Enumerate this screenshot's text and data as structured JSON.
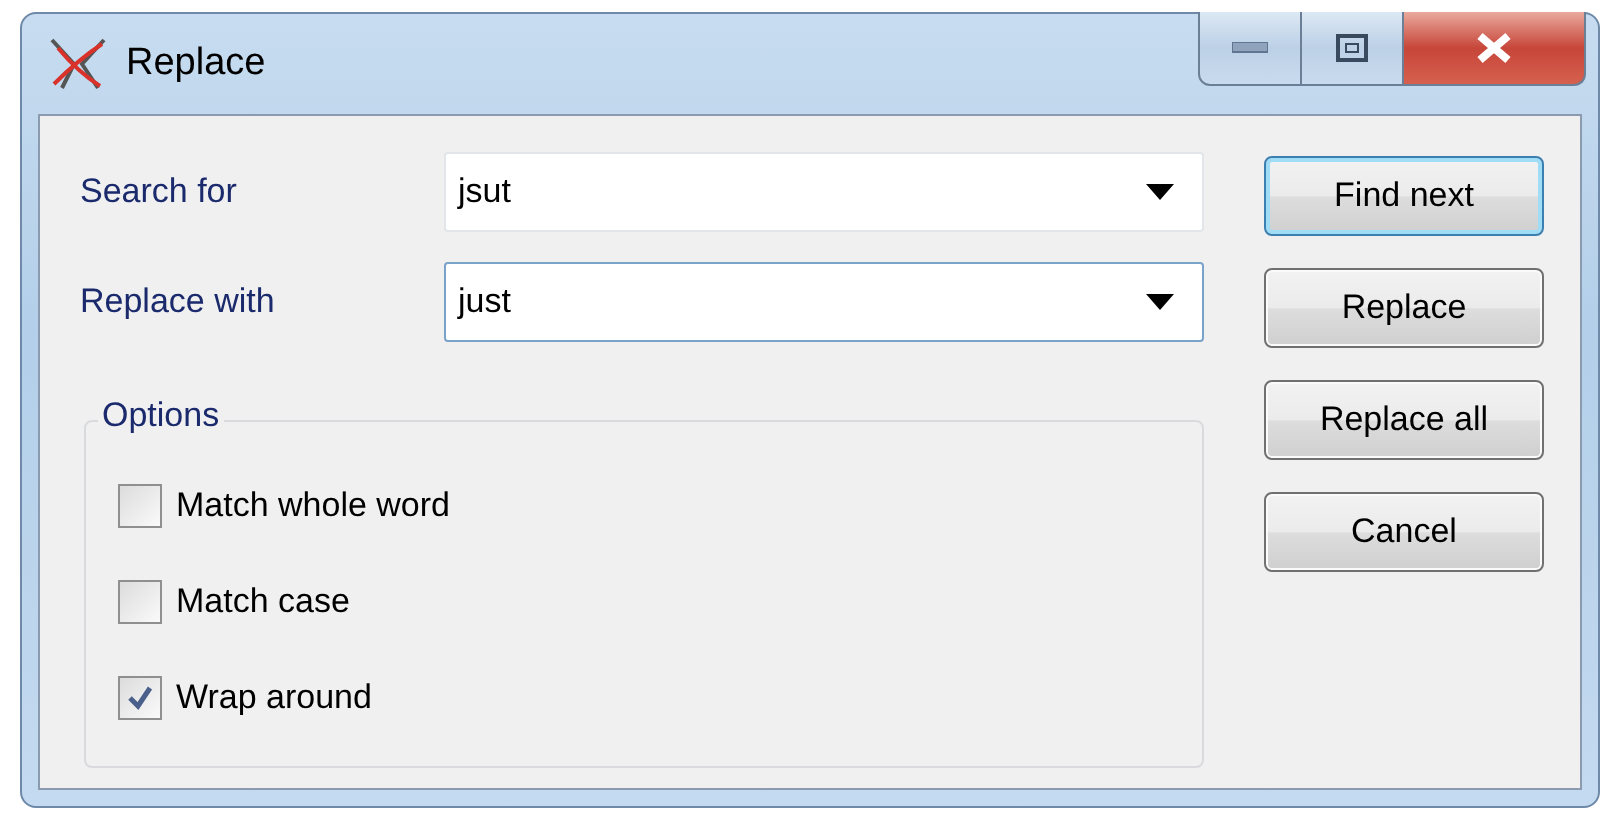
{
  "window": {
    "title": "Replace",
    "controls": [
      {
        "kind": "minimize"
      },
      {
        "kind": "maximize"
      },
      {
        "kind": "close"
      }
    ]
  },
  "fields": [
    {
      "label": "Search for",
      "value": "jsut",
      "focused": false
    },
    {
      "label": "Replace with",
      "value": "just",
      "focused": true
    }
  ],
  "options": {
    "title": "Options",
    "items": [
      {
        "label": "Match whole word",
        "checked": false
      },
      {
        "label": "Match case",
        "checked": false
      },
      {
        "label": "Wrap around",
        "checked": true
      }
    ]
  },
  "buttons": [
    {
      "label": "Find next",
      "default": true
    },
    {
      "label": "Replace",
      "default": false
    },
    {
      "label": "Replace all",
      "default": false
    },
    {
      "label": "Cancel",
      "default": false
    }
  ]
}
